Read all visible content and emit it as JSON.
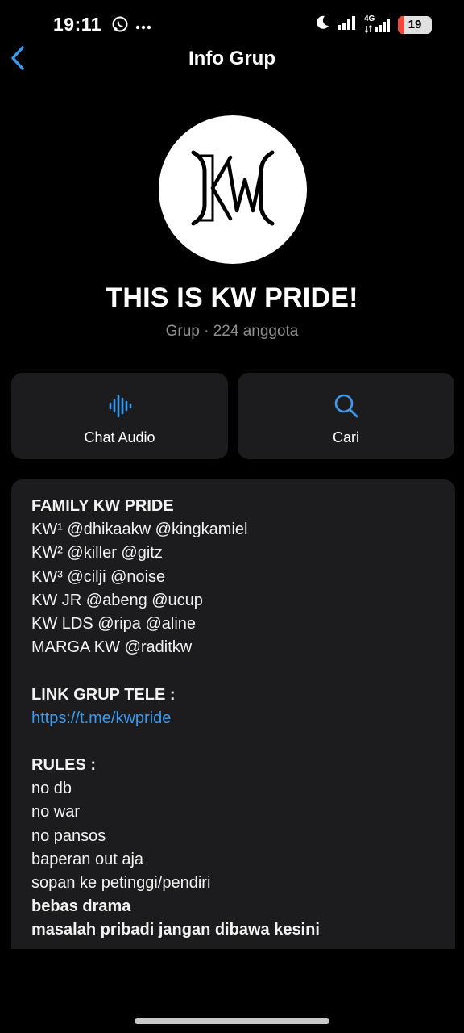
{
  "status_bar": {
    "time": "19:11",
    "network_label": "4G",
    "battery_level": "19",
    "battery_fraction": 0.19,
    "accent_color": "#e84b3c"
  },
  "header": {
    "title": "Info Grup",
    "back_icon": "chevron-left-icon",
    "back_color": "#3b9aee"
  },
  "group": {
    "avatar_icon": "kw-logo",
    "name": "THIS IS KW PRIDE!",
    "meta": "Grup · 224 anggota"
  },
  "actions": [
    {
      "label": "Chat Audio",
      "icon": "audio-waveform-icon"
    },
    {
      "label": "Cari",
      "icon": "search-icon"
    }
  ],
  "description": {
    "lines": [
      {
        "text": "FAMILY KW PRIDE",
        "style": "bold"
      },
      {
        "text": "KW¹ @dhikaakw @kingkamiel",
        "style": "normal"
      },
      {
        "text": "KW² @killer @gitz",
        "style": "normal"
      },
      {
        "text": "KW³ @cilji @noise",
        "style": "normal"
      },
      {
        "text": "KW JR @abeng @ucup",
        "style": "normal"
      },
      {
        "text": "KW LDS @ripa @aline",
        "style": "normal"
      },
      {
        "text": "MARGA KW @raditkw",
        "style": "normal"
      },
      {
        "text": "",
        "style": "blank"
      },
      {
        "text": "LINK GRUP TELE :",
        "style": "bold"
      },
      {
        "text": "https://t.me/kwpride",
        "style": "link"
      },
      {
        "text": "",
        "style": "blank"
      },
      {
        "text": "RULES :",
        "style": "bold"
      },
      {
        "text": "no db",
        "style": "normal"
      },
      {
        "text": "no war",
        "style": "normal"
      },
      {
        "text": "no pansos",
        "style": "normal"
      },
      {
        "text": "baperan out aja",
        "style": "normal"
      },
      {
        "text": "sopan ke petinggi/pendiri",
        "style": "normal"
      },
      {
        "text": "bebas drama",
        "style": "bold"
      },
      {
        "text": "masalah pribadi jangan dibawa kesini",
        "style": "bold"
      }
    ]
  }
}
